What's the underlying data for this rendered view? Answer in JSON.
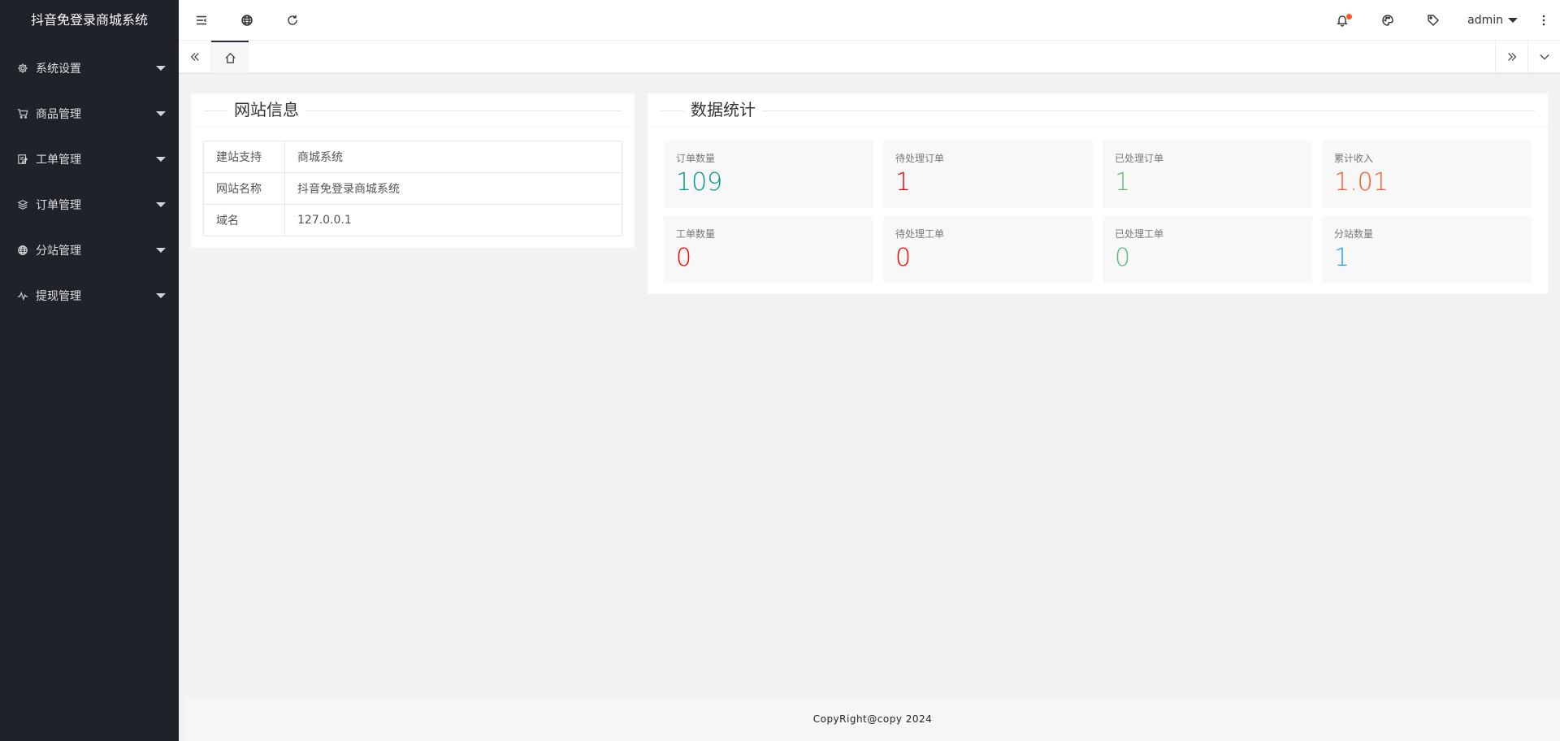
{
  "app": {
    "title": "抖音免登录商城系统"
  },
  "sidebar": {
    "items": [
      {
        "label": "系统设置",
        "icon": "gear-icon"
      },
      {
        "label": "商品管理",
        "icon": "cart-icon"
      },
      {
        "label": "工单管理",
        "icon": "form-icon"
      },
      {
        "label": "订单管理",
        "icon": "layers-icon"
      },
      {
        "label": "分站管理",
        "icon": "globe-icon"
      },
      {
        "label": "提现管理",
        "icon": "pulse-icon"
      }
    ]
  },
  "header": {
    "user": "admin",
    "notification_dot_color": "#ff5722"
  },
  "site_info": {
    "title": "网站信息",
    "rows": [
      {
        "key": "建站支持",
        "value": "商城系统"
      },
      {
        "key": "网站名称",
        "value": "抖音免登录商城系统"
      },
      {
        "key": "域名",
        "value": "127.0.0.1"
      }
    ]
  },
  "stats": {
    "title": "数据统计",
    "items": [
      {
        "label": "订单数量",
        "value": "109",
        "color": "#009688"
      },
      {
        "label": "待处理订单",
        "value": "1",
        "color": "#ff0000"
      },
      {
        "label": "已处理订单",
        "value": "1",
        "color": "#5fb878"
      },
      {
        "label": "累计收入",
        "value": "1.01",
        "color": "#ff5722"
      },
      {
        "label": "工单数量",
        "value": "0",
        "color": "#ff0000"
      },
      {
        "label": "待处理工单",
        "value": "0",
        "color": "#ff0000"
      },
      {
        "label": "已处理工单",
        "value": "0",
        "color": "#5fb878"
      },
      {
        "label": "分站数量",
        "value": "1",
        "color": "#1e9fff"
      }
    ]
  },
  "footer": {
    "text": "CopyRight@copy 2024"
  }
}
